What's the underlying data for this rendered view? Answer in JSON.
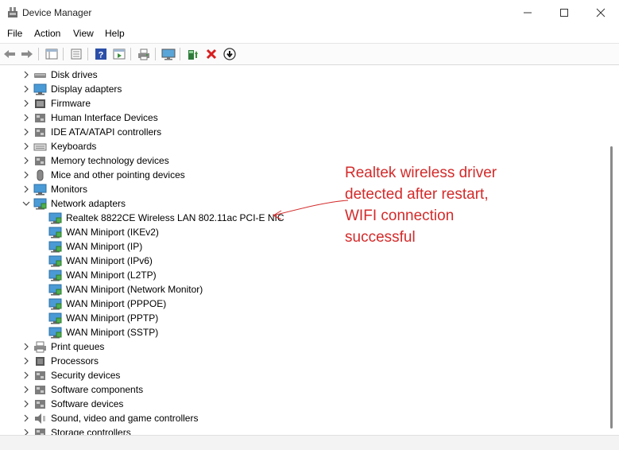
{
  "window": {
    "title": "Device Manager"
  },
  "menu": [
    "File",
    "Action",
    "View",
    "Help"
  ],
  "tree": {
    "top_categories": [
      "Disk drives",
      "Display adapters",
      "Firmware",
      "Human Interface Devices",
      "IDE ATA/ATAPI controllers",
      "Keyboards",
      "Memory technology devices",
      "Mice and other pointing devices",
      "Monitors"
    ],
    "network": {
      "label": "Network adapters",
      "children": [
        "Realtek 8822CE Wireless LAN 802.11ac PCI-E NIC",
        "WAN Miniport (IKEv2)",
        "WAN Miniport (IP)",
        "WAN Miniport (IPv6)",
        "WAN Miniport (L2TP)",
        "WAN Miniport (Network Monitor)",
        "WAN Miniport (PPPOE)",
        "WAN Miniport (PPTP)",
        "WAN Miniport (SSTP)"
      ]
    },
    "bottom_categories": [
      "Print queues",
      "Processors",
      "Security devices",
      "Software components",
      "Software devices",
      "Sound, video and game controllers",
      "Storage controllers"
    ]
  },
  "annotation": {
    "lines": [
      "Realtek wireless driver",
      "detected after restart,",
      "WIFI connection",
      "successful"
    ],
    "color": "#d42a2a"
  }
}
